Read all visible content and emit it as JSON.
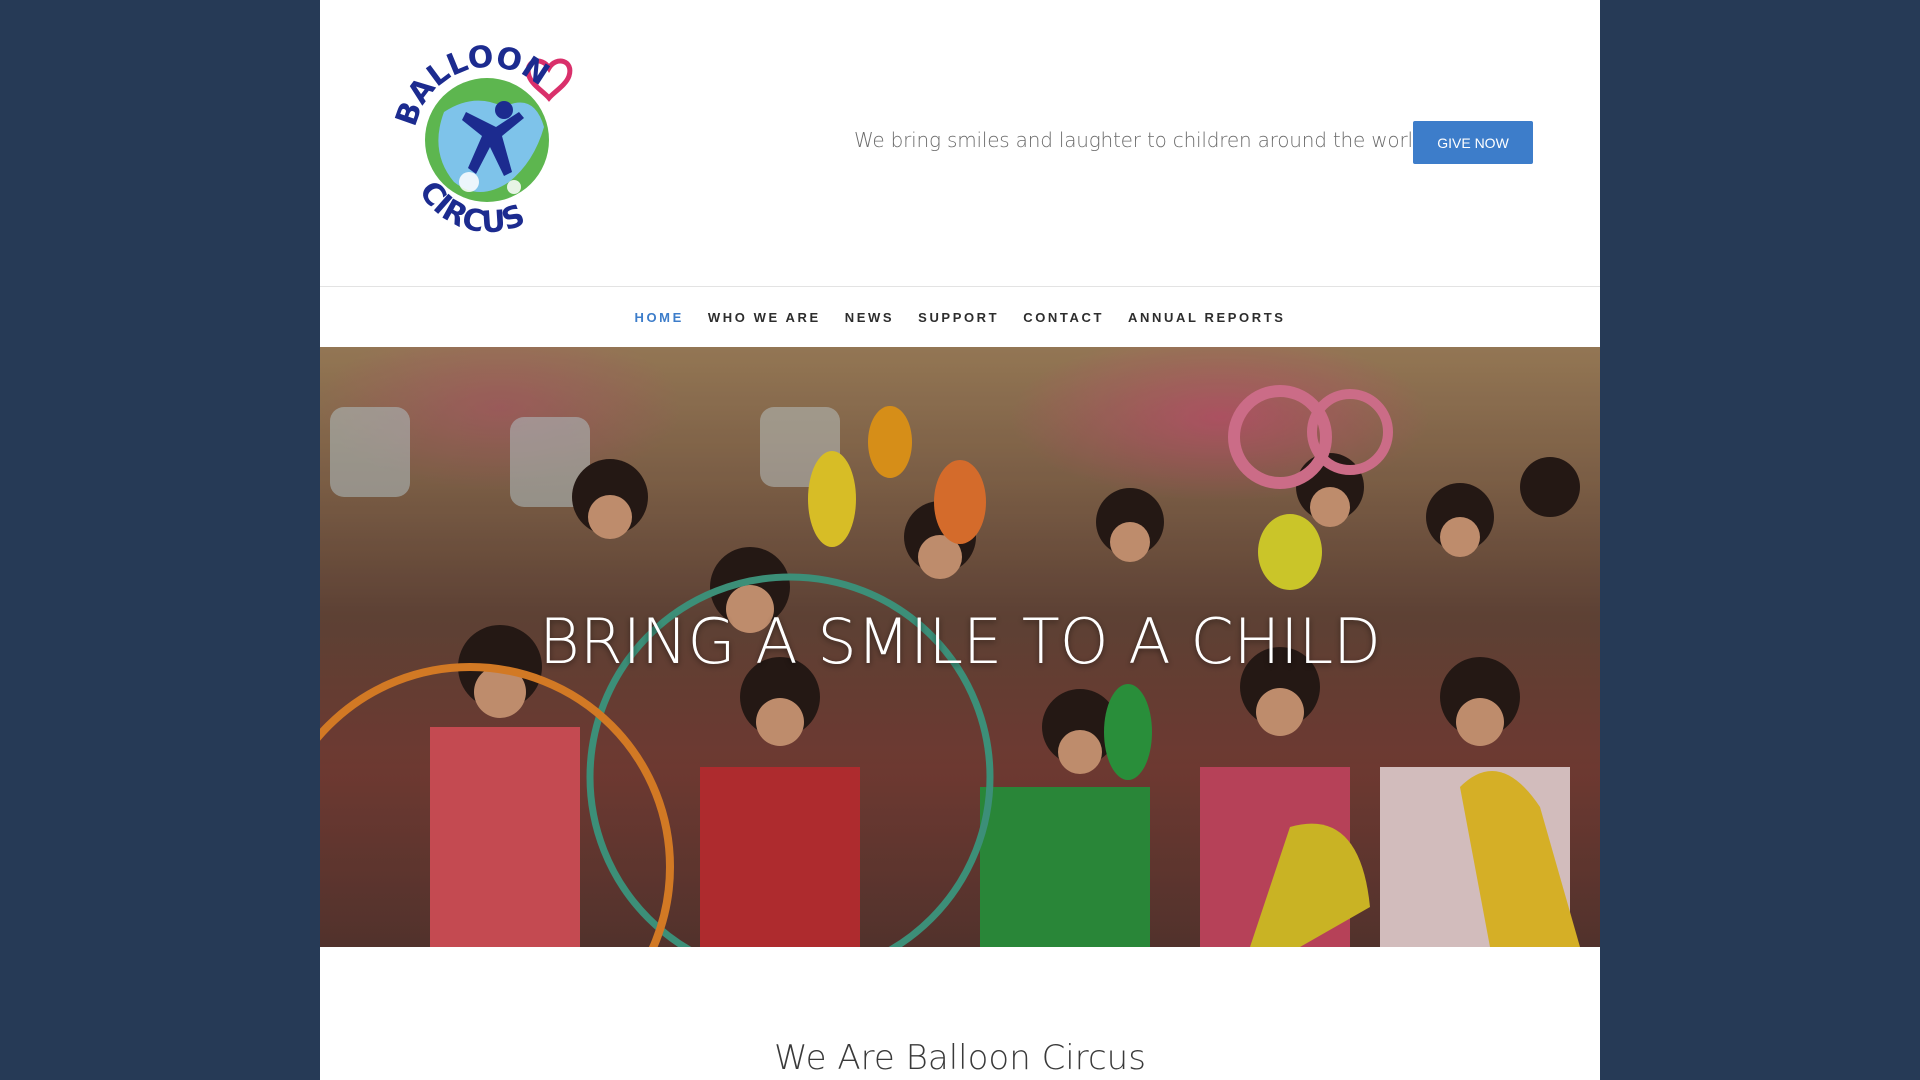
{
  "brand": {
    "logo_text_top": "BALLOON",
    "logo_text_bottom": "CIRCUS",
    "logo_icon": "balloon-circus-logo"
  },
  "header": {
    "tagline": "We bring smiles and laughter to children around the world.",
    "give_label": "GIVE NOW"
  },
  "nav": {
    "items": [
      {
        "label": "HOME",
        "active": true
      },
      {
        "label": "WHO WE ARE",
        "active": false
      },
      {
        "label": "NEWS",
        "active": false
      },
      {
        "label": "SUPPORT",
        "active": false
      },
      {
        "label": "CONTACT",
        "active": false
      },
      {
        "label": "ANNUAL REPORTS",
        "active": false
      }
    ]
  },
  "hero": {
    "title": "BRING A SMILE TO A CHILD",
    "image": "children-playing-circus-photo"
  },
  "intro": {
    "title": "We Are Balloon Circus"
  },
  "colors": {
    "background": "#263a56",
    "accent": "#3d7dca",
    "nav_text": "#2d2d2d",
    "logo_blue": "#1c2b8f",
    "logo_green": "#4bb35a",
    "logo_pink": "#d9306b"
  }
}
